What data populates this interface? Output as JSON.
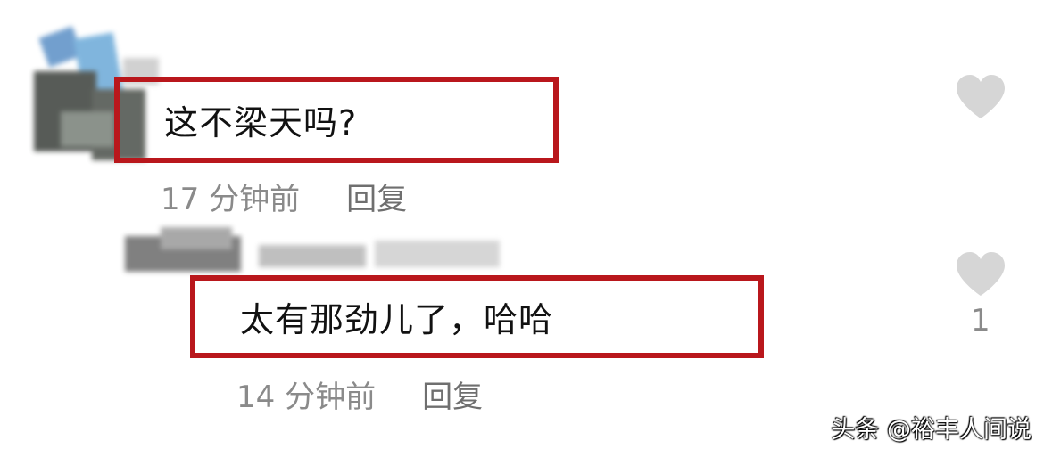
{
  "comments": [
    {
      "text": "这不梁天吗?",
      "time": "17 分钟前",
      "reply_label": "回复",
      "like_count": ""
    },
    {
      "text": "太有那劲儿了，哈哈",
      "time": "14 分钟前",
      "reply_label": "回复",
      "like_count": "1"
    }
  ],
  "watermark": "头条 @裕丰人间说",
  "colors": {
    "highlight_border": "#b9171c",
    "meta_text": "#8a8a8a",
    "like_icon": "#d6d6d6"
  },
  "icons": {
    "like": "heart-icon"
  }
}
